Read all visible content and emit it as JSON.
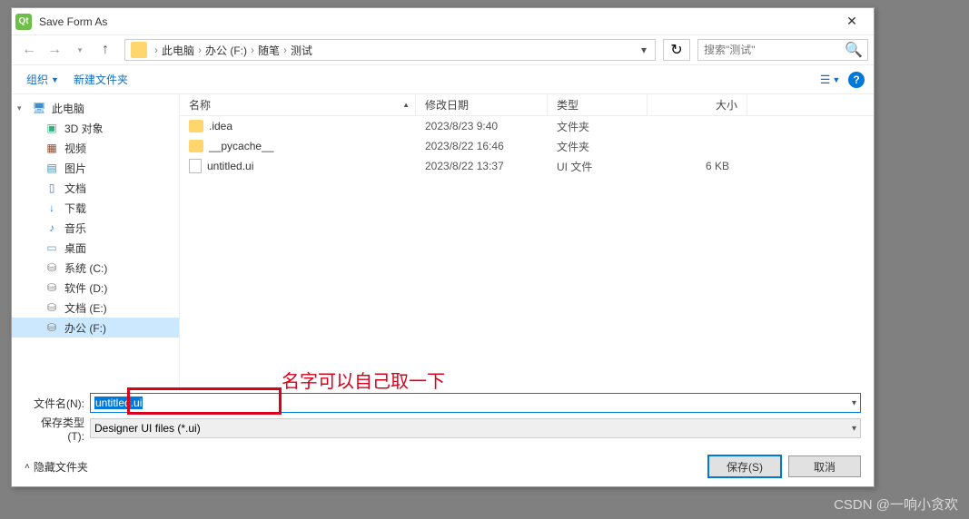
{
  "window_title": "Save Form As",
  "breadcrumb": {
    "items": [
      "此电脑",
      "办公 (F:)",
      "随笔",
      "测试"
    ]
  },
  "search": {
    "placeholder": "搜索\"测试\""
  },
  "toolbar": {
    "organize": "组织",
    "new_folder": "新建文件夹"
  },
  "tree": {
    "items": [
      {
        "label": "此电脑",
        "icon": "ico-pc",
        "root": true
      },
      {
        "label": "3D 对象",
        "icon": "ico-3d"
      },
      {
        "label": "视频",
        "icon": "ico-video"
      },
      {
        "label": "图片",
        "icon": "ico-pic"
      },
      {
        "label": "文档",
        "icon": "ico-doc"
      },
      {
        "label": "下载",
        "icon": "ico-down"
      },
      {
        "label": "音乐",
        "icon": "ico-music"
      },
      {
        "label": "桌面",
        "icon": "ico-desk"
      },
      {
        "label": "系统 (C:)",
        "icon": "ico-drive"
      },
      {
        "label": "软件 (D:)",
        "icon": "ico-drive"
      },
      {
        "label": "文档 (E:)",
        "icon": "ico-drive"
      },
      {
        "label": "办公 (F:)",
        "icon": "ico-drive",
        "sel": true
      }
    ]
  },
  "columns": {
    "name": "名称",
    "date": "修改日期",
    "type": "类型",
    "size": "大小"
  },
  "files": [
    {
      "name": ".idea",
      "date": "2023/8/23 9:40",
      "type": "文件夹",
      "size": "",
      "kind": "folder"
    },
    {
      "name": "__pycache__",
      "date": "2023/8/22 16:46",
      "type": "文件夹",
      "size": "",
      "kind": "folder"
    },
    {
      "name": "untitled.ui",
      "date": "2023/8/22 13:37",
      "type": "UI 文件",
      "size": "6 KB",
      "kind": "file"
    }
  ],
  "annotation_text": "名字可以自己取一下",
  "form": {
    "filename_label": "文件名(N):",
    "filename_value": "untitled.ui",
    "filetype_label": "保存类型(T):",
    "filetype_value": "Designer UI files (*.ui)"
  },
  "footer": {
    "hide_folders": "隐藏文件夹",
    "save": "保存(S)",
    "cancel": "取消"
  },
  "watermark": "CSDN @一响小贪欢"
}
